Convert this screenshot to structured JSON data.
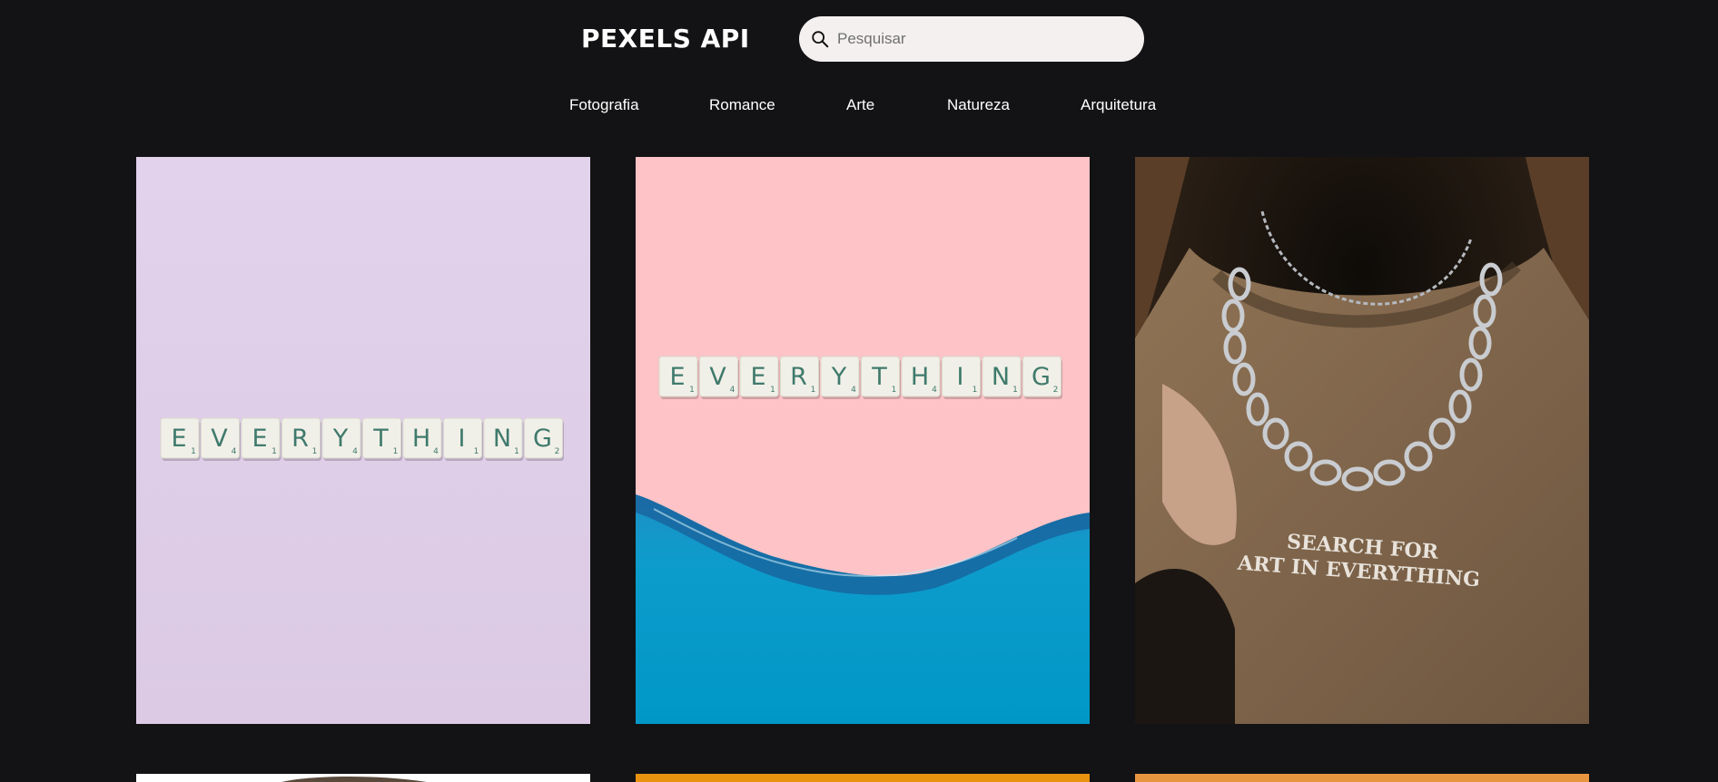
{
  "app": {
    "logo": "PEXELS API"
  },
  "search": {
    "placeholder": "Pesquisar",
    "value": ""
  },
  "nav": {
    "items": [
      {
        "label": "Fotografia"
      },
      {
        "label": "Romance"
      },
      {
        "label": "Arte"
      },
      {
        "label": "Natureza"
      },
      {
        "label": "Arquitetura"
      }
    ]
  },
  "photos": [
    {
      "subject": "scrabble tiles spelling EVERYTHING on lilac background",
      "tiles": [
        "E",
        "V",
        "E",
        "R",
        "Y",
        "T",
        "H",
        "I",
        "N",
        "G"
      ],
      "tile_scores": [
        "1",
        "4",
        "1",
        "1",
        "4",
        "1",
        "4",
        "1",
        "1",
        "2"
      ],
      "bg": "#e0cfea"
    },
    {
      "subject": "scrabble tiles spelling EVERYTHING on pink background above blue water wave",
      "tiles": [
        "E",
        "V",
        "E",
        "R",
        "Y",
        "T",
        "H",
        "I",
        "N",
        "G"
      ],
      "tile_scores": [
        "1",
        "4",
        "1",
        "1",
        "4",
        "1",
        "4",
        "1",
        "1",
        "2"
      ],
      "bg": "#fdc3c6",
      "water": "#0a9cc8"
    },
    {
      "subject": "person wearing brown sweater with silver chain necklaces",
      "shirt_text_line1": "SEARCH FOR",
      "shirt_text_line2": "ART IN EVERYTHING",
      "bg": "#2b2118"
    },
    {
      "subject": "portrait with curly hair on white background",
      "bg": "#ffffff"
    },
    {
      "subject": "orange toned photo",
      "bg": "#e8920f"
    },
    {
      "subject": "orange toned photo",
      "bg": "#e8953f"
    }
  ],
  "colors": {
    "background": "#131315",
    "search_bg": "#f4f0f0",
    "tile_text": "#3f7a6c"
  }
}
